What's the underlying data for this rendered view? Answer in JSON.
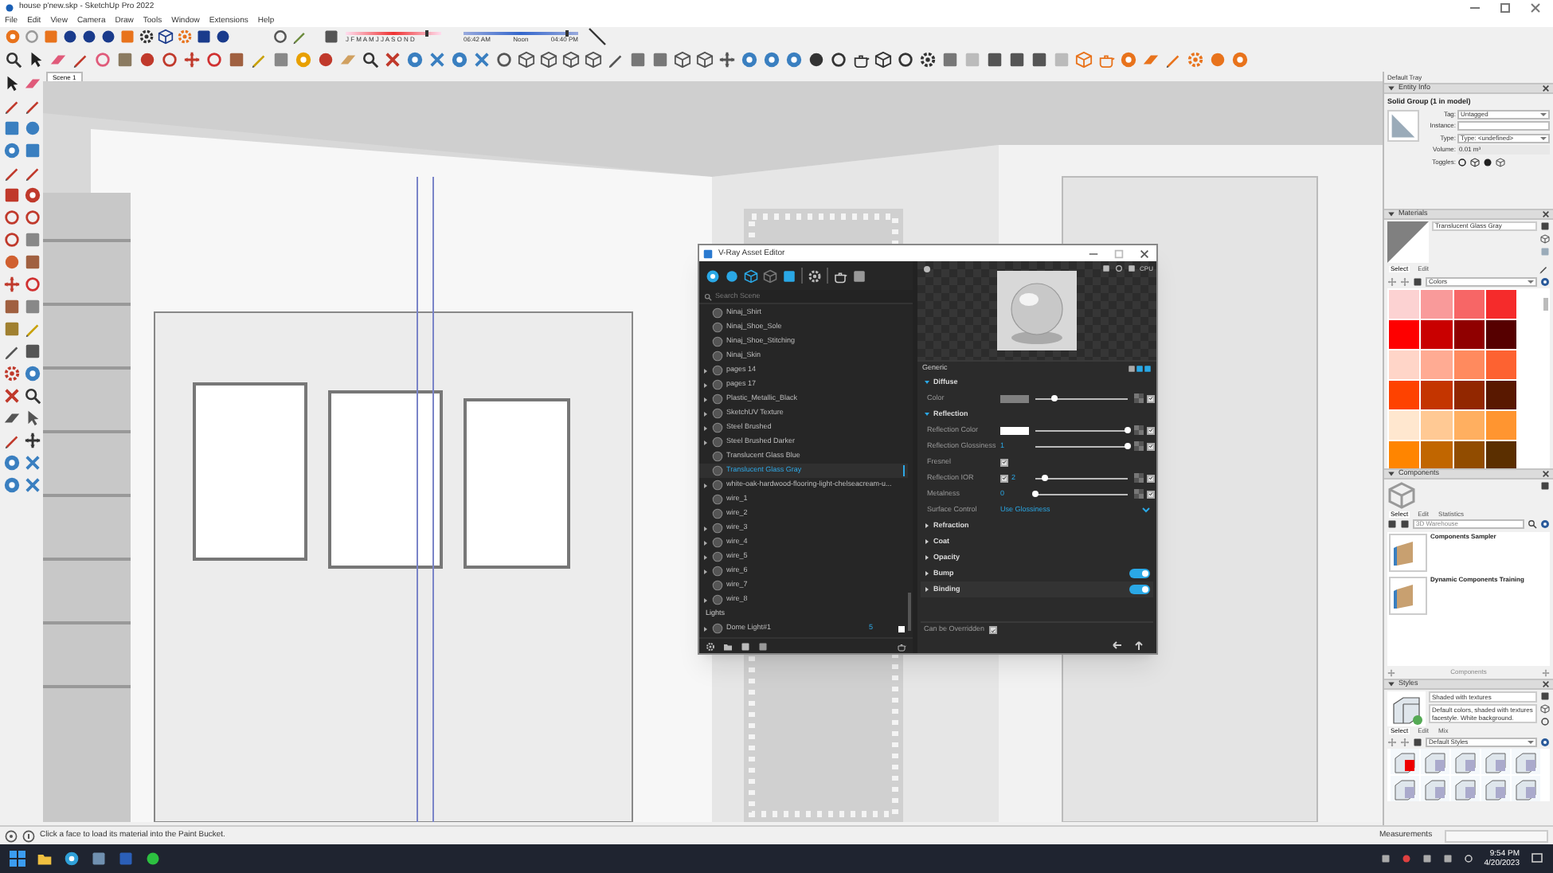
{
  "window": {
    "title": "house p'new.skp - SketchUp Pro 2022"
  },
  "menu": [
    "File",
    "Edit",
    "View",
    "Camera",
    "Draw",
    "Tools",
    "Window",
    "Extensions",
    "Help"
  ],
  "shadows": {
    "months": "J F M A M J J A S O N D",
    "month_slider": {
      "level": 0.85
    },
    "times": [
      "06:42 AM",
      "Noon",
      "04:40 PM"
    ],
    "time_slider": {
      "level": 0.9
    }
  },
  "scene_tabs": [
    {
      "label": "Scene 1",
      "selected": true
    }
  ],
  "vray": {
    "title": "V-Ray Asset Editor",
    "search": {
      "placeholder": "Search Scene"
    },
    "materials": [
      {
        "name": "Ninaj_Shirt",
        "expandable": false,
        "selected": false
      },
      {
        "name": "Ninaj_Shoe_Sole",
        "expandable": false,
        "selected": false
      },
      {
        "name": "Ninaj_Shoe_Stitching",
        "expandable": false,
        "selected": false
      },
      {
        "name": "Ninaj_Skin",
        "expandable": false,
        "selected": false
      },
      {
        "name": "pages 14",
        "expandable": true,
        "selected": false
      },
      {
        "name": "pages 17",
        "expandable": true,
        "selected": false
      },
      {
        "name": "Plastic_Metallic_Black",
        "expandable": true,
        "selected": false
      },
      {
        "name": "SketchUV Texture",
        "expandable": true,
        "selected": false
      },
      {
        "name": "Steel Brushed",
        "expandable": true,
        "selected": false
      },
      {
        "name": "Steel Brushed Darker",
        "expandable": true,
        "selected": false
      },
      {
        "name": "Translucent Glass Blue",
        "expandable": false,
        "selected": false
      },
      {
        "name": "Translucent Glass Gray",
        "expandable": false,
        "selected": true
      },
      {
        "name": "white-oak-hardwood-flooring-light-chelseacream-u...",
        "expandable": true,
        "selected": false
      },
      {
        "name": "wire_1",
        "expandable": false,
        "selected": false
      },
      {
        "name": "wire_2",
        "expandable": false,
        "selected": false
      },
      {
        "name": "wire_3",
        "expandable": true,
        "selected": false
      },
      {
        "name": "wire_4",
        "expandable": true,
        "selected": false
      },
      {
        "name": "wire_5",
        "expandable": true,
        "selected": false
      },
      {
        "name": "wire_6",
        "expandable": true,
        "selected": false
      },
      {
        "name": "wire_7",
        "expandable": false,
        "selected": false
      },
      {
        "name": "wire_8",
        "expandable": true,
        "selected": false
      }
    ],
    "lights_heading": "Lights",
    "lights": [
      {
        "name": "Dome Light#1",
        "expandable": true,
        "count": "5"
      }
    ],
    "engine": "CPU",
    "section": "Generic",
    "groups": [
      {
        "label": "Diffuse",
        "expanded": true,
        "rows": [
          {
            "kind": "swatch",
            "label": "Color",
            "color": "#808080",
            "level": 0.2,
            "checked": true
          }
        ]
      },
      {
        "label": "Reflection",
        "expanded": true,
        "rows": [
          {
            "kind": "swatch",
            "label": "Reflection Color",
            "color": "#ffffff",
            "level": 1,
            "checked": true
          },
          {
            "kind": "value",
            "label": "Reflection Glossiness",
            "value": "1",
            "level": 1,
            "checked": true
          },
          {
            "kind": "check",
            "label": "Fresnel",
            "checked": true
          },
          {
            "kind": "checkvalue",
            "label": "Reflection IOR",
            "enabled": true,
            "value": "2",
            "level": 0.1,
            "checked": true
          },
          {
            "kind": "value",
            "label": "Metalness",
            "value": "0",
            "level": 0,
            "checked": true
          },
          {
            "kind": "dropdown",
            "label": "Surface Control",
            "value": "Use Glossiness"
          }
        ]
      },
      {
        "label": "Refraction",
        "expanded": false
      },
      {
        "label": "Coat",
        "expanded": false
      },
      {
        "label": "Opacity",
        "expanded": false
      },
      {
        "label": "Bump",
        "expanded": false,
        "on": true
      },
      {
        "label": "Binding",
        "expanded": false,
        "on": true
      }
    ],
    "override": {
      "label": "Can be Overridden",
      "checked": true
    }
  },
  "tray": {
    "title": "Default Tray",
    "entity_info": {
      "heading": "Entity Info",
      "object": "Solid Group (1 in model)",
      "tag_label": "Tag:",
      "tag": "Untagged",
      "instance_label": "Instance:",
      "type_label": "Type:",
      "type": "Type: <undefined>",
      "volume_label": "Volume:",
      "volume": "0.01 m³",
      "toggles_label": "Toggles:"
    },
    "materials": {
      "heading": "Materials",
      "name": "Translucent Glass Gray",
      "tabs": [
        {
          "label": "Select",
          "selected": true
        },
        {
          "label": "Edit",
          "selected": false
        }
      ],
      "library": "Colors",
      "swatches": [
        {
          "color": "#fcd2d2"
        },
        {
          "color": "#f99a9a"
        },
        {
          "color": "#f76666"
        },
        {
          "color": "#f52b2b"
        },
        {
          "color": "#fe0000"
        },
        {
          "color": "#c90000"
        },
        {
          "color": "#900000"
        },
        {
          "color": "#560000"
        },
        {
          "color": "#ffd5c8"
        },
        {
          "color": "#ffab93"
        },
        {
          "color": "#ff8a5e"
        },
        {
          "color": "#fd6231"
        },
        {
          "color": "#fe4200"
        },
        {
          "color": "#c43500"
        },
        {
          "color": "#922700"
        },
        {
          "color": "#591800"
        },
        {
          "color": "#ffe7cf"
        },
        {
          "color": "#ffc994"
        },
        {
          "color": "#ffaf60"
        },
        {
          "color": "#ff9530"
        },
        {
          "color": "#ff8500"
        },
        {
          "color": "#c16600"
        },
        {
          "color": "#914c00"
        },
        {
          "color": "#5b2f00"
        }
      ]
    },
    "components": {
      "heading": "Components",
      "tabs": [
        {
          "label": "Select",
          "selected": true
        },
        {
          "label": "Edit",
          "selected": false
        },
        {
          "label": "Statistics",
          "selected": false
        }
      ],
      "search": {
        "placeholder": "3D Warehouse"
      },
      "items": [
        "Components Sampler",
        "Dynamic Components Training"
      ],
      "footer": "Components"
    },
    "styles": {
      "heading": "Styles",
      "name": "Shaded with textures",
      "description": "Default colors, shaded with textures facestyle. White background.",
      "tabs": [
        {
          "label": "Select",
          "selected": true
        },
        {
          "label": "Edit",
          "selected": false
        },
        {
          "label": "Mix",
          "selected": false
        }
      ],
      "library": "Default Styles"
    }
  },
  "status_bar": {
    "message": "Click a face to load its material into the Paint Bucket.",
    "measurements_label": "Measurements"
  },
  "taskbar": {
    "time": "9:54 PM",
    "date": "4/20/2023"
  }
}
